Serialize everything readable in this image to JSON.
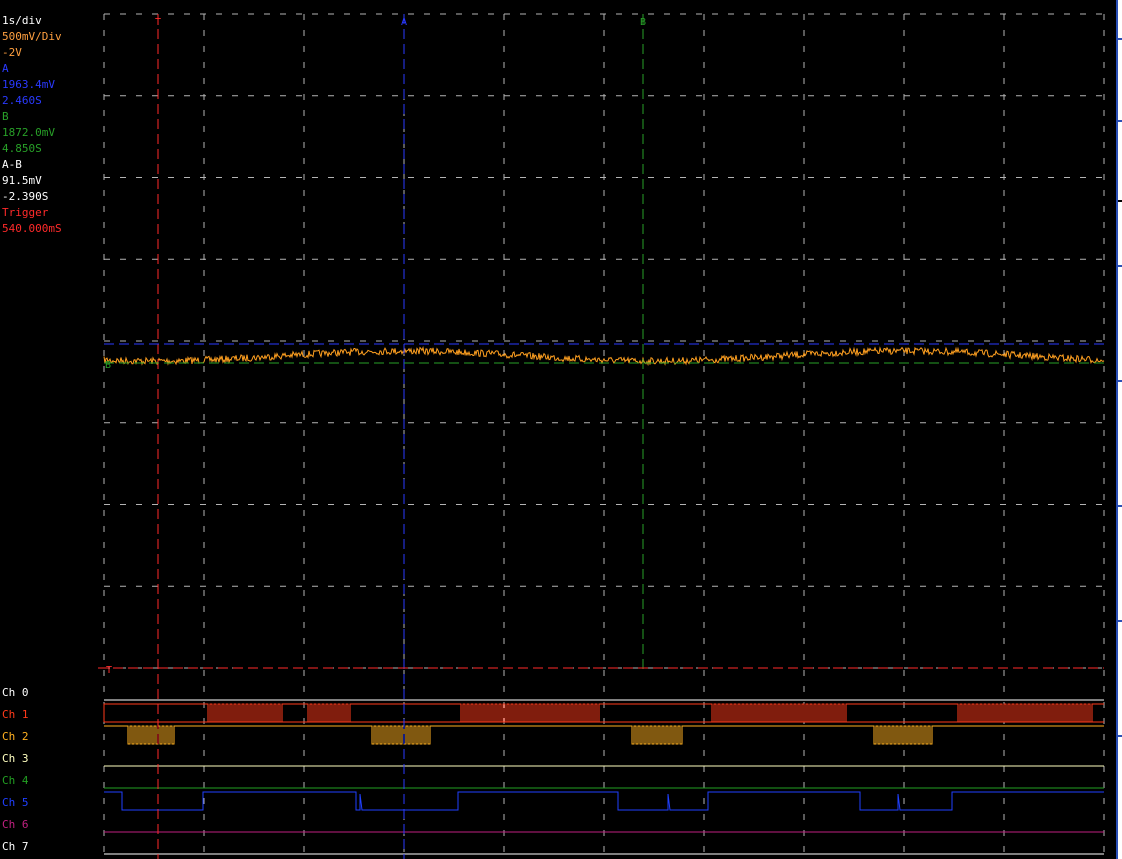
{
  "readout": {
    "timebase": "1s/div",
    "volts_per_div": "500mV/Div",
    "offset": "-2V",
    "cursor_a_label": "A",
    "cursor_a_voltage": "1963.4mV",
    "cursor_a_time": "2.460S",
    "cursor_b_label": "B",
    "cursor_b_voltage": "1872.0mV",
    "cursor_b_time": "4.850S",
    "delta_label": "A-B",
    "delta_voltage": "91.5mV",
    "delta_time": "-2.390S",
    "trigger_label": "Trigger",
    "trigger_time": "540.000mS"
  },
  "markers": {
    "trigger": "T",
    "cursor_a": "A",
    "cursor_b": "B"
  },
  "channels": [
    {
      "label": "Ch 0",
      "color": "#ffffff"
    },
    {
      "label": "Ch 1",
      "color": "#ff3a1a"
    },
    {
      "label": "Ch 2",
      "color": "#ffb020"
    },
    {
      "label": "Ch 3",
      "color": "#ffffc0"
    },
    {
      "label": "Ch 4",
      "color": "#22a022"
    },
    {
      "label": "Ch 5",
      "color": "#2040ff"
    },
    {
      "label": "Ch 6",
      "color": "#c02080"
    },
    {
      "label": "Ch 7",
      "color": "#ffffff"
    }
  ],
  "colors": {
    "grid": "#b4b4b4",
    "trace": "#ffa020",
    "trigger": "#ff2a2a",
    "cursor_a": "#2a3aff",
    "cursor_b": "#28a028",
    "text_white": "#ffffff",
    "text_orange": "#ffa040",
    "text_blue": "#2a3aff",
    "text_green": "#28a028",
    "text_red": "#ff2a2a"
  }
}
